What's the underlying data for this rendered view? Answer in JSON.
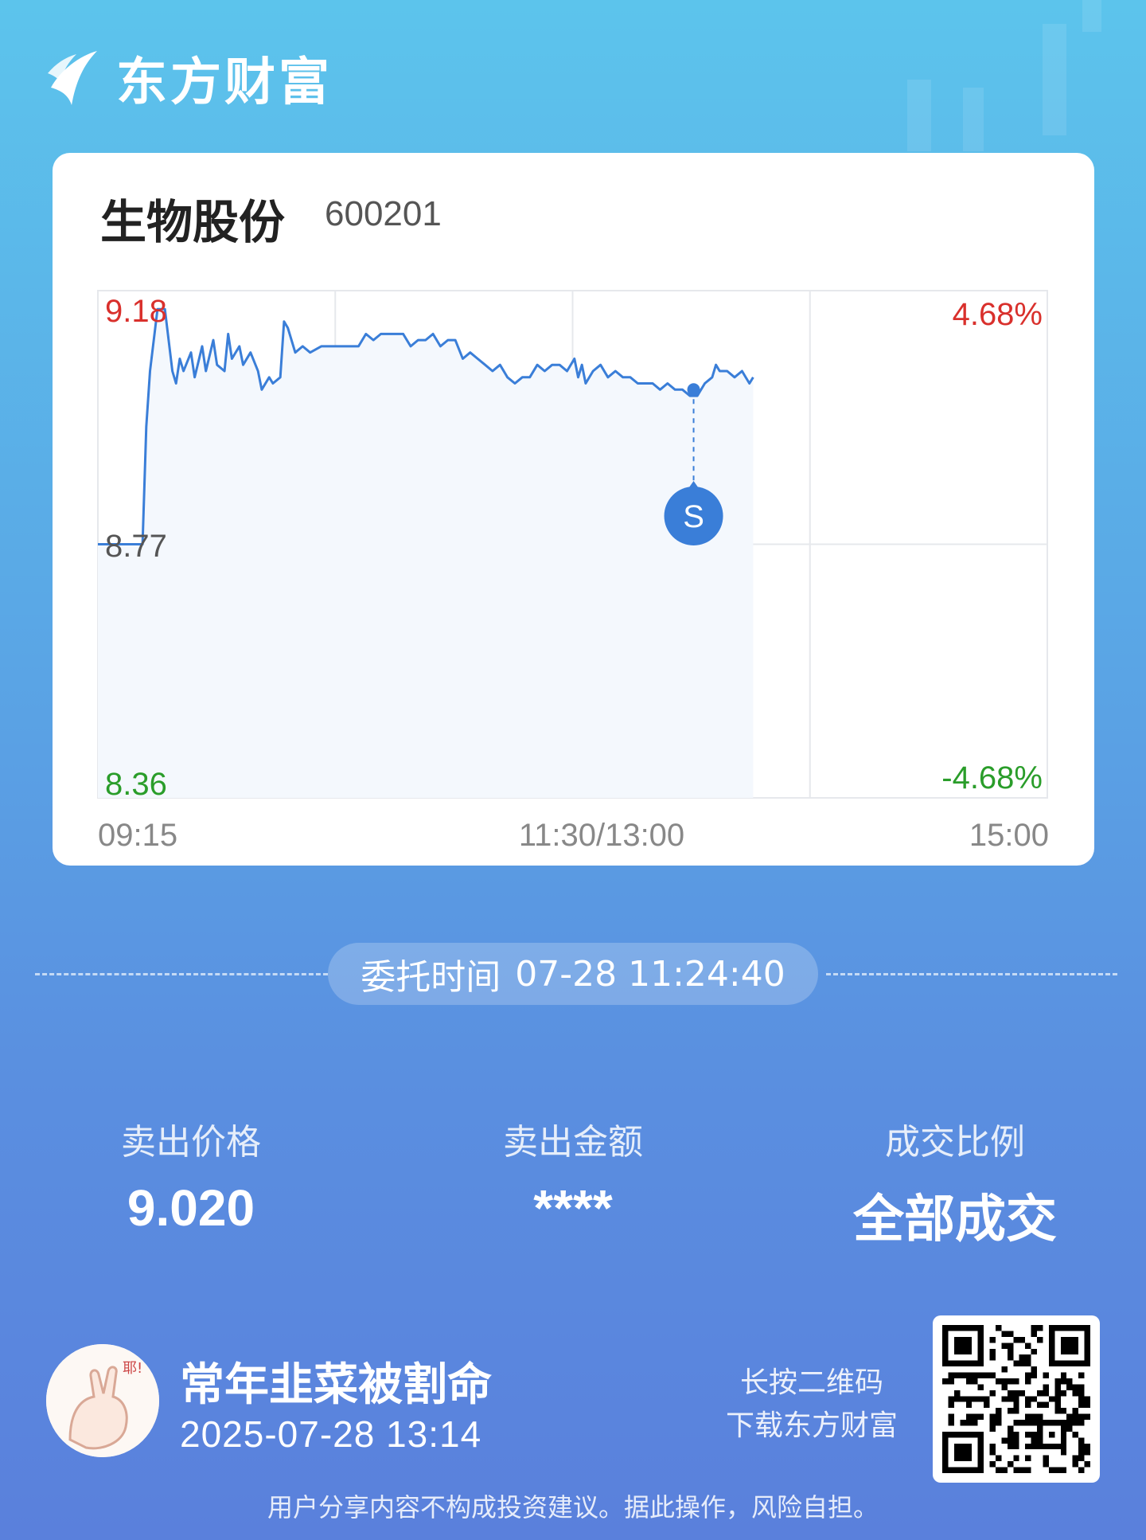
{
  "brand": {
    "name": "东方财富"
  },
  "stock": {
    "name": "生物股份",
    "code": "600201"
  },
  "chart_data": {
    "type": "line",
    "title": "",
    "xlabel": "",
    "ylabel": "",
    "y_labels": {
      "top": "9.18",
      "mid": "8.77",
      "bottom": "8.36"
    },
    "pct_labels": {
      "top": "4.68%",
      "bottom": "-4.68%"
    },
    "x_ticks": [
      "09:15",
      "11:30/13:00",
      "15:00"
    ],
    "ylim": [
      8.36,
      9.18
    ],
    "prev_close": 8.77,
    "session_minutes": 255,
    "x_unit": "minutes after 09:15 in the 09:15–15:00 trading session",
    "series": [
      {
        "points": [
          [
            0,
            8.77
          ],
          [
            8,
            8.77
          ],
          [
            12,
            8.77
          ],
          [
            13,
            8.96
          ],
          [
            14,
            9.05
          ],
          [
            16,
            9.15
          ],
          [
            18,
            9.15
          ],
          [
            20,
            9.05
          ],
          [
            21,
            9.03
          ],
          [
            22,
            9.07
          ],
          [
            23,
            9.05
          ],
          [
            25,
            9.08
          ],
          [
            26,
            9.04
          ],
          [
            28,
            9.09
          ],
          [
            29,
            9.05
          ],
          [
            31,
            9.1
          ],
          [
            32,
            9.06
          ],
          [
            34,
            9.05
          ],
          [
            35,
            9.11
          ],
          [
            36,
            9.07
          ],
          [
            38,
            9.09
          ],
          [
            39,
            9.06
          ],
          [
            41,
            9.08
          ],
          [
            43,
            9.05
          ],
          [
            44,
            9.02
          ],
          [
            46,
            9.04
          ],
          [
            47,
            9.03
          ],
          [
            49,
            9.04
          ],
          [
            50,
            9.13
          ],
          [
            51,
            9.12
          ],
          [
            53,
            9.08
          ],
          [
            55,
            9.09
          ],
          [
            57,
            9.08
          ],
          [
            60,
            9.09
          ],
          [
            63,
            9.09
          ],
          [
            66,
            9.09
          ],
          [
            70,
            9.09
          ],
          [
            72,
            9.11
          ],
          [
            74,
            9.1
          ],
          [
            76,
            9.11
          ],
          [
            79,
            9.11
          ],
          [
            82,
            9.11
          ],
          [
            84,
            9.09
          ],
          [
            86,
            9.1
          ],
          [
            88,
            9.1
          ],
          [
            90,
            9.11
          ],
          [
            92,
            9.09
          ],
          [
            94,
            9.1
          ],
          [
            96,
            9.1
          ],
          [
            98,
            9.07
          ],
          [
            100,
            9.08
          ],
          [
            102,
            9.07
          ],
          [
            104,
            9.06
          ],
          [
            106,
            9.05
          ],
          [
            108,
            9.06
          ],
          [
            110,
            9.04
          ],
          [
            112,
            9.03
          ],
          [
            114,
            9.04
          ],
          [
            116,
            9.04
          ],
          [
            118,
            9.06
          ],
          [
            120,
            9.05
          ],
          [
            122,
            9.06
          ],
          [
            124,
            9.06
          ],
          [
            126,
            9.05
          ],
          [
            128,
            9.07
          ],
          [
            129,
            9.04
          ],
          [
            130,
            9.06
          ],
          [
            131,
            9.03
          ],
          [
            133,
            9.05
          ],
          [
            135,
            9.06
          ],
          [
            137,
            9.04
          ],
          [
            139,
            9.05
          ],
          [
            141,
            9.04
          ],
          [
            143,
            9.04
          ],
          [
            145,
            9.03
          ],
          [
            147,
            9.03
          ],
          [
            149,
            9.03
          ],
          [
            151,
            9.02
          ],
          [
            153,
            9.03
          ],
          [
            155,
            9.02
          ],
          [
            157,
            9.02
          ],
          [
            159,
            9.01
          ],
          [
            161,
            9.01
          ],
          [
            163,
            9.03
          ],
          [
            165,
            9.04
          ],
          [
            166,
            9.06
          ],
          [
            167,
            9.05
          ],
          [
            169,
            9.05
          ],
          [
            171,
            9.04
          ],
          [
            173,
            9.05
          ],
          [
            174,
            9.04
          ],
          [
            175,
            9.03
          ],
          [
            176,
            9.04
          ]
        ]
      }
    ],
    "marker": {
      "label": "S",
      "x": 160,
      "y": 9.02
    },
    "grid": true
  },
  "order": {
    "time_label": "委托时间",
    "time_value": "07-28 11:24:40"
  },
  "stats": [
    {
      "label": "卖出价格",
      "value": "9.020"
    },
    {
      "label": "卖出金额",
      "value": "****"
    },
    {
      "label": "成交比例",
      "value": "全部成交"
    }
  ],
  "user": {
    "name": "常年韭菜被割命",
    "share_time": "2025-07-28 13:14",
    "avatar_text": "耶!"
  },
  "qr": {
    "hint_line1": "长按二维码",
    "hint_line2": "下载东方财富"
  },
  "disclaimer": "用户分享内容不构成投资建议。据此操作，风险自担。",
  "colors": {
    "up": "#d9302c",
    "down": "#2a9d2a",
    "line": "#3a7ed8",
    "fill": "#f4f8fd",
    "grid": "#e6e8ec"
  }
}
